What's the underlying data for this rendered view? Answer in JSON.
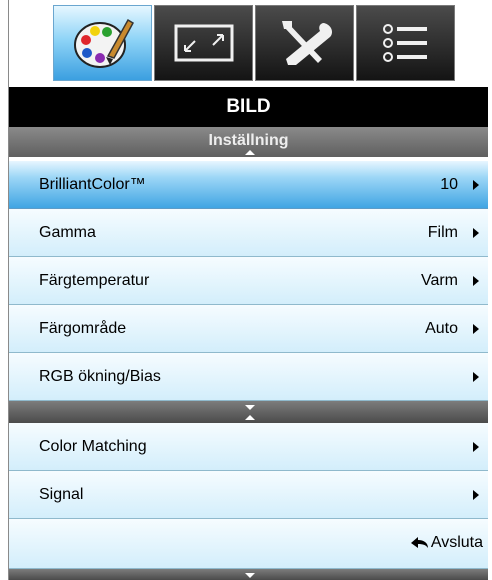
{
  "tabs": [
    {
      "name": "picture",
      "icon": "palette-icon",
      "active": true
    },
    {
      "name": "screen",
      "icon": "screen-resize-icon",
      "active": false
    },
    {
      "name": "settings",
      "icon": "tools-icon",
      "active": false
    },
    {
      "name": "options",
      "icon": "list-icon",
      "active": false
    }
  ],
  "header": {
    "title": "BILD",
    "subtitle": "Inställning"
  },
  "menu_items": [
    {
      "label": "BrilliantColor™",
      "value": "10"
    },
    {
      "label": "Gamma",
      "value": "Film"
    },
    {
      "label": "Färgtemperatur",
      "value": "Varm"
    },
    {
      "label": "Färgområde",
      "value": "Auto"
    },
    {
      "label": "RGB ökning/Bias",
      "value": ""
    }
  ],
  "menu_items_2": [
    {
      "label": "Color Matching",
      "value": ""
    },
    {
      "label": "Signal",
      "value": ""
    }
  ],
  "footer": {
    "exit_label": "Avsluta"
  },
  "colors": {
    "accent": "#40a5e3",
    "header_bg": "#000000",
    "row_bg": "#d3eefb"
  }
}
